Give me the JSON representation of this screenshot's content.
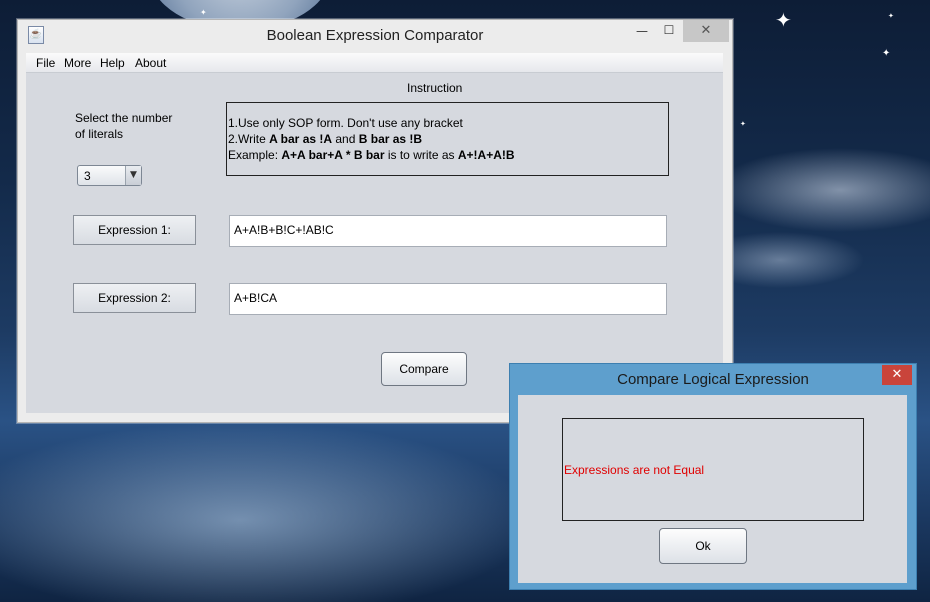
{
  "window": {
    "title": "Boolean Expression Comparator",
    "icon": "java-cup-icon",
    "controls": {
      "minimize": "—",
      "maximize": "☐",
      "close": "✕"
    }
  },
  "menu": [
    "File",
    "More",
    "Help",
    "About"
  ],
  "instruction": {
    "heading": "Instruction",
    "line1": "1.Use only SOP form. Don't use any bracket",
    "line2": {
      "prefix": "2.Write ",
      "bold1": "A bar as !A",
      "mid": " and ",
      "bold2": "B bar as !B"
    },
    "line3": {
      "prefix": "Example: ",
      "bold1": "A+A bar+A * B bar",
      "mid": " is to write as ",
      "bold2": "A+!A+A!B"
    }
  },
  "literals": {
    "label_line1": "Select the number",
    "label_line2": "of literals",
    "selected": "3",
    "arrow": "▼"
  },
  "expressions": [
    {
      "label": "Expression 1:",
      "value": "A+A!B+B!C+!AB!C"
    },
    {
      "label": "Expression 2:",
      "value": "A+B!CA"
    }
  ],
  "compare_button": "Compare",
  "dialog": {
    "title": "Compare Logical Expression",
    "close": "✕",
    "message": "Expressions are not Equal",
    "message_color": "#e00000",
    "ok_button": "Ok"
  }
}
